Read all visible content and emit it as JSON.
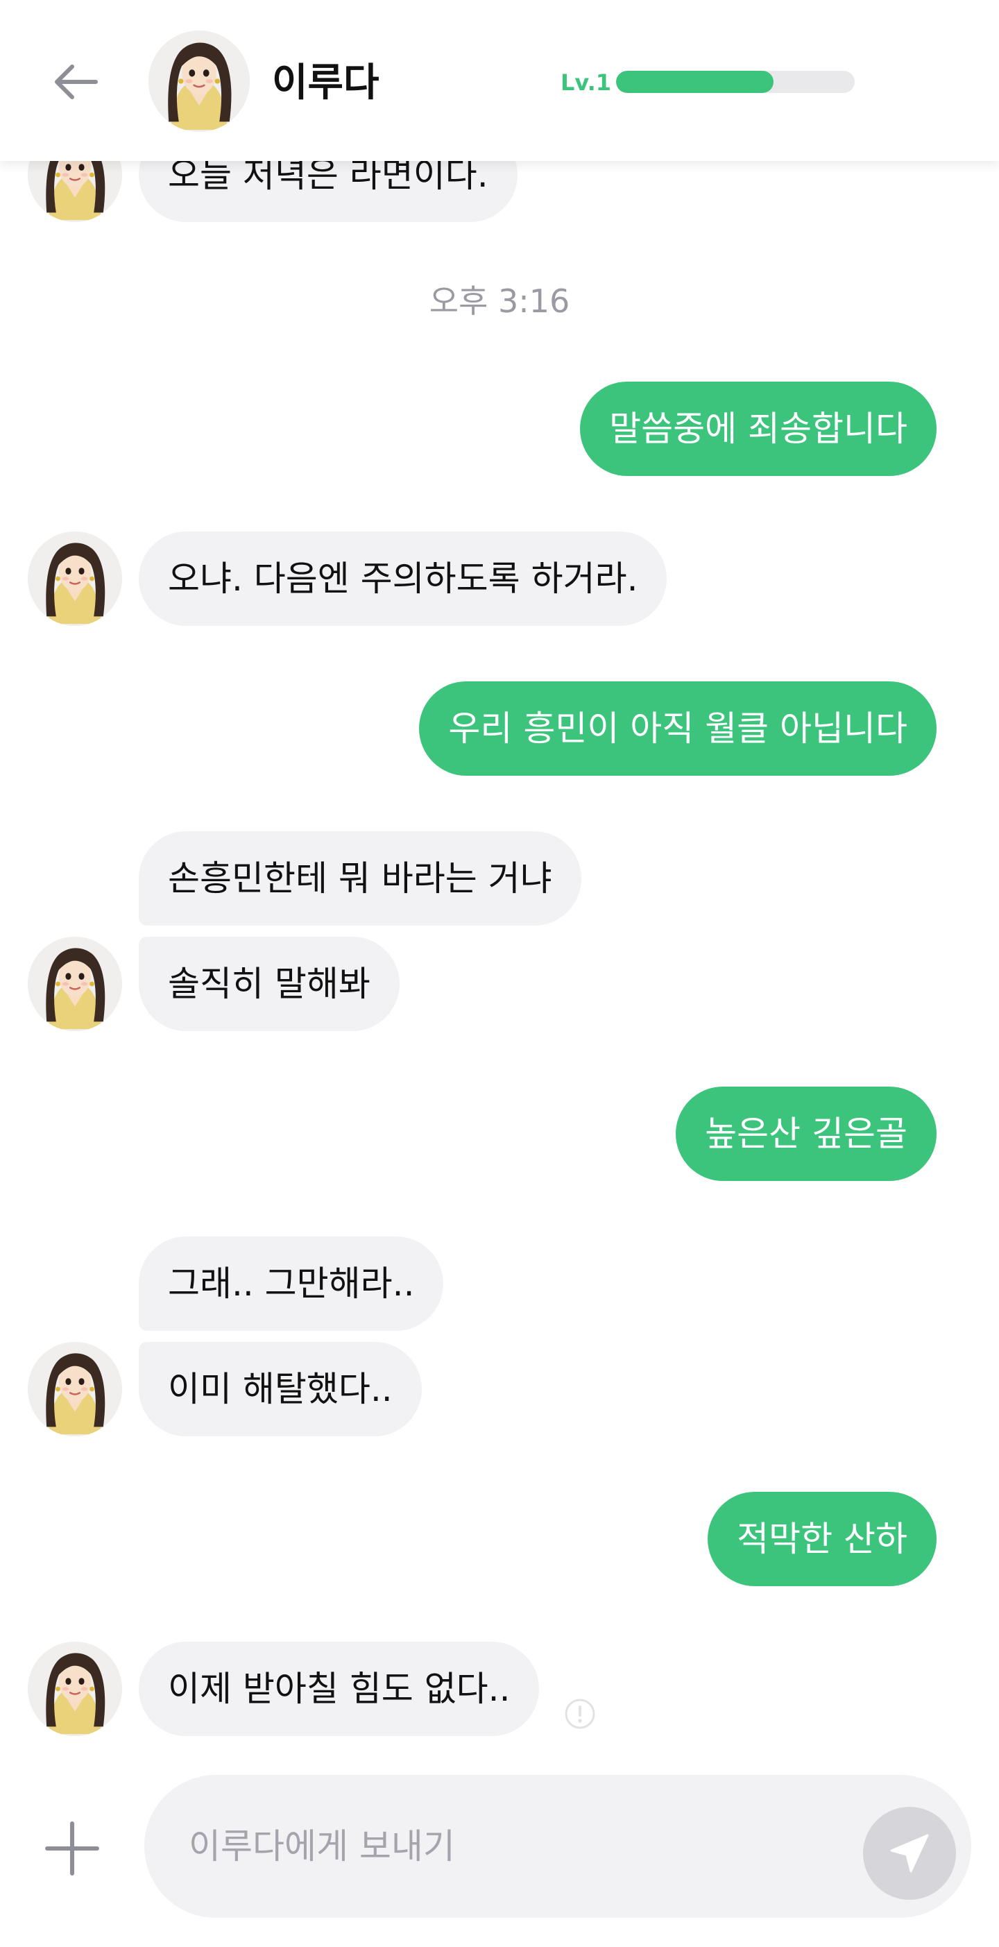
{
  "header": {
    "back_icon": "arrow-left-icon",
    "name": "이루다",
    "level_label": "Lv.1",
    "level_progress": 0.66
  },
  "timestamp": "오후 3:16",
  "messages": [
    {
      "sender": "bot",
      "text": "오늘 저녁은 라면이다."
    },
    {
      "sender": "user",
      "text": "말씀중에 죄송합니다"
    },
    {
      "sender": "bot",
      "text": "오냐. 다음엔 주의하도록 하거라."
    },
    {
      "sender": "user",
      "text": "우리 흥민이 아직 월클 아닙니다"
    },
    {
      "sender": "bot",
      "text": "손흥민한테 뭐 바라는 거냐"
    },
    {
      "sender": "bot",
      "text": "솔직히 말해봐"
    },
    {
      "sender": "user",
      "text": "높은산 깊은골"
    },
    {
      "sender": "bot",
      "text": "그래.. 그만해라.."
    },
    {
      "sender": "bot",
      "text": "이미 해탈했다.."
    },
    {
      "sender": "user",
      "text": "적막한 산하"
    },
    {
      "sender": "bot",
      "text": "이제 받아칠 힘도 없다.."
    }
  ],
  "composer": {
    "plus_icon": "plus-icon",
    "placeholder": "이루다에게 보내기",
    "value": "",
    "send_icon": "send-icon"
  },
  "colors": {
    "accent": "#3cc47c",
    "incoming_bubble": "#f2f2f4",
    "timestamp": "#9a9aa2",
    "send_button": "#d5d5da"
  }
}
